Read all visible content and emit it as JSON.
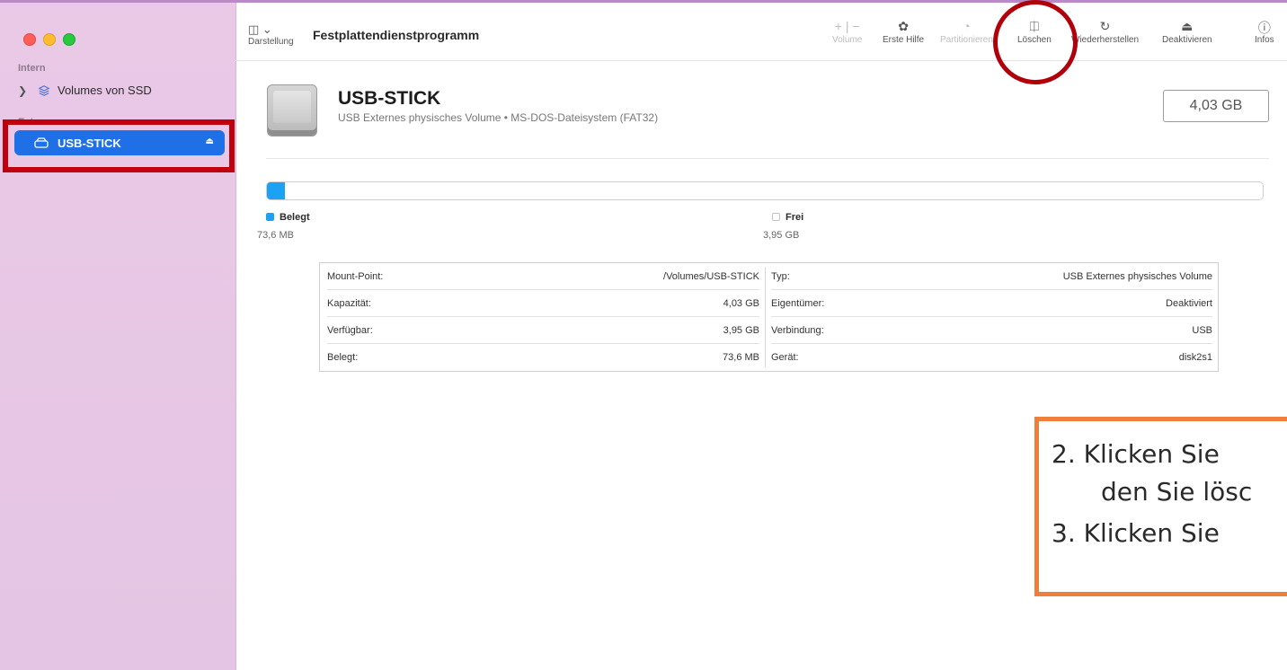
{
  "window": {
    "title": "Festplattendienstprogramm"
  },
  "sidebar": {
    "section_intern": "Intern",
    "section_extern": "Extern",
    "items": [
      {
        "label": "Volumes von SSD"
      },
      {
        "label": "USB-STICK"
      }
    ]
  },
  "toolbar": {
    "view_label": "Darstellung",
    "volume_label": "Volume",
    "first_aid_label": "Erste Hilfe",
    "partition_label": "Partitionieren",
    "erase_label": "Löschen",
    "restore_label": "Wiederherstellen",
    "deactivate_label": "Deaktivieren",
    "info_label": "Infos"
  },
  "disk": {
    "name": "USB-STICK",
    "description": "USB Externes physisches Volume • MS-DOS-Dateisystem (FAT32)",
    "capacity": "4,03 GB",
    "used_fraction": 0.018
  },
  "usage": {
    "used_label": "Belegt",
    "used_value": "73,6 MB",
    "free_label": "Frei",
    "free_value": "3,95 GB"
  },
  "info": {
    "left": [
      {
        "key": "Mount-Point:",
        "value": "/Volumes/USB-STICK"
      },
      {
        "key": "Kapazität:",
        "value": "4,03 GB"
      },
      {
        "key": "Verfügbar:",
        "value": "3,95 GB"
      },
      {
        "key": "Belegt:",
        "value": "73,6 MB"
      }
    ],
    "right": [
      {
        "key": "Typ:",
        "value": "USB Externes physisches Volume"
      },
      {
        "key": "Eigentümer:",
        "value": "Deaktiviert"
      },
      {
        "key": "Verbindung:",
        "value": "USB"
      },
      {
        "key": "Gerät:",
        "value": "disk2s1"
      }
    ]
  },
  "instructions": {
    "line1": "2.    Klicken Sie",
    "line2": "den Sie lösc",
    "line3": "3.    Klicken Sie"
  },
  "colors": {
    "accent": "#1f6fe6",
    "used_bar": "#1ba2f4",
    "highlight_red": "#c0000c",
    "instruction_border": "#ef7d3b"
  }
}
